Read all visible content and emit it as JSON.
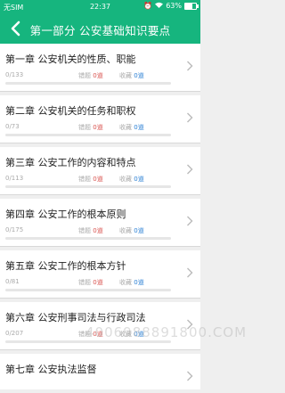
{
  "status": {
    "carrier": "无SIM",
    "time": "22:37",
    "battery": "63%"
  },
  "header": {
    "title": "第一部分 公安基础知识要点"
  },
  "labels": {
    "wrong": "错题",
    "fav": "收藏",
    "unit": "道"
  },
  "chapters": [
    {
      "name": "第一章 公安机关的性质、职能",
      "count": "0/133",
      "wrong": "0",
      "fav": "0"
    },
    {
      "name": "第二章 公安机关的任务和职权",
      "count": "0/73",
      "wrong": "0",
      "fav": "0"
    },
    {
      "name": "第三章 公安工作的内容和特点",
      "count": "0/113",
      "wrong": "0",
      "fav": "0"
    },
    {
      "name": "第四章 公安工作的根本原则",
      "count": "0/175",
      "wrong": "0",
      "fav": "0"
    },
    {
      "name": "第五章 公安工作的根本方针",
      "count": "0/81",
      "wrong": "0",
      "fav": "0"
    },
    {
      "name": "第六章 公安刑事司法与行政司法",
      "count": "0/207",
      "wrong": "0",
      "fav": "0"
    },
    {
      "name": "第七章 公安执法监督"
    }
  ],
  "watermark": "4006988891800.COM",
  "colors": {
    "accent": "#16b57e",
    "wrong": "#d9534f",
    "fav": "#2a7fd4"
  }
}
